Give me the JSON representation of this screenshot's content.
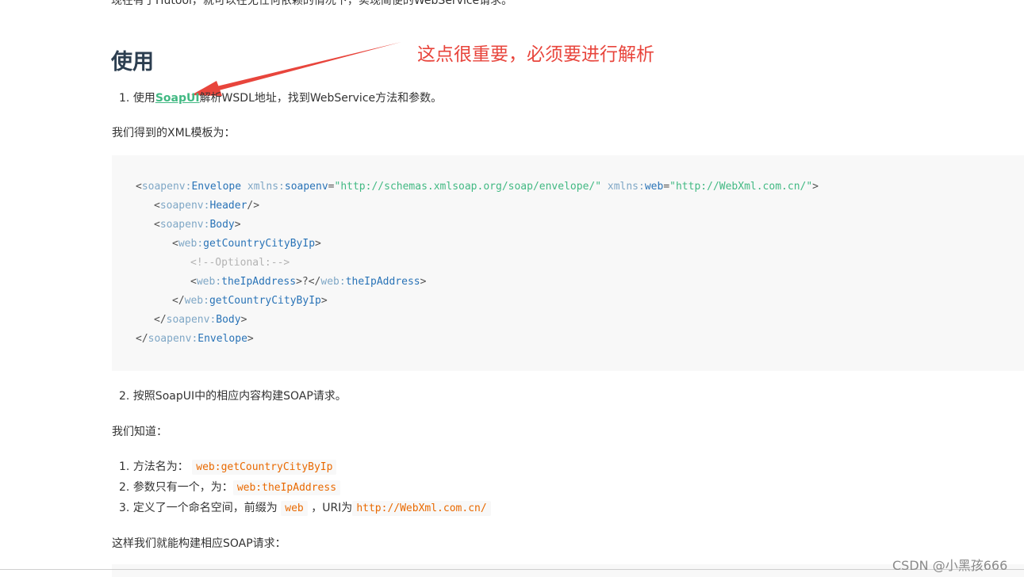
{
  "top_cutoff_text": "现在有了Hutool，就可以在无任何依赖的情况下，实现简便的WebService请求。",
  "section_heading": "使用",
  "annotation_text": "这点很重要，必须要进行解析",
  "step1": {
    "number": "1.",
    "prefix": "使用",
    "link": "SoapUI",
    "suffix": "解析WSDL地址，找到WebService方法和参数。"
  },
  "xml_intro": "我们得到的XML模板为：",
  "code_lines": [
    {
      "indent": 0,
      "tokens": [
        [
          "p",
          "<"
        ],
        [
          "ns",
          "soapenv"
        ],
        [
          "ns",
          ":"
        ],
        [
          "name",
          "Envelope"
        ],
        [
          "p",
          " "
        ],
        [
          "ns",
          "xmlns"
        ],
        [
          "ns",
          ":"
        ],
        [
          "attr",
          "soapenv"
        ],
        [
          "p",
          "="
        ],
        [
          "str",
          "\"http://schemas.xmlsoap.org/soap/envelope/\""
        ],
        [
          "p",
          " "
        ],
        [
          "ns",
          "xmlns"
        ],
        [
          "ns",
          ":"
        ],
        [
          "attr",
          "web"
        ],
        [
          "p",
          "="
        ],
        [
          "str",
          "\"http://WebXml.com.cn/\""
        ],
        [
          "p",
          ">"
        ]
      ]
    },
    {
      "indent": 1,
      "tokens": [
        [
          "p",
          "<"
        ],
        [
          "ns",
          "soapenv"
        ],
        [
          "ns",
          ":"
        ],
        [
          "name",
          "Header"
        ],
        [
          "p",
          "/>"
        ]
      ]
    },
    {
      "indent": 1,
      "tokens": [
        [
          "p",
          "<"
        ],
        [
          "ns",
          "soapenv"
        ],
        [
          "ns",
          ":"
        ],
        [
          "name",
          "Body"
        ],
        [
          "p",
          ">"
        ]
      ]
    },
    {
      "indent": 2,
      "tokens": [
        [
          "p",
          "<"
        ],
        [
          "ns",
          "web"
        ],
        [
          "ns",
          ":"
        ],
        [
          "name",
          "getCountryCityByIp"
        ],
        [
          "p",
          ">"
        ]
      ]
    },
    {
      "indent": 3,
      "tokens": [
        [
          "cm",
          "<!--Optional:-->"
        ]
      ]
    },
    {
      "indent": 3,
      "tokens": [
        [
          "p",
          "<"
        ],
        [
          "ns",
          "web"
        ],
        [
          "ns",
          ":"
        ],
        [
          "name",
          "theIpAddress"
        ],
        [
          "p",
          ">?</"
        ],
        [
          "ns",
          "web"
        ],
        [
          "ns",
          ":"
        ],
        [
          "name",
          "theIpAddress"
        ],
        [
          "p",
          ">"
        ]
      ]
    },
    {
      "indent": 2,
      "tokens": [
        [
          "p",
          "</"
        ],
        [
          "ns",
          "web"
        ],
        [
          "ns",
          ":"
        ],
        [
          "name",
          "getCountryCityByIp"
        ],
        [
          "p",
          ">"
        ]
      ]
    },
    {
      "indent": 1,
      "tokens": [
        [
          "p",
          "</"
        ],
        [
          "ns",
          "soapenv"
        ],
        [
          "ns",
          ":"
        ],
        [
          "name",
          "Body"
        ],
        [
          "p",
          ">"
        ]
      ]
    },
    {
      "indent": 0,
      "tokens": [
        [
          "p",
          "</"
        ],
        [
          "ns",
          "soapenv"
        ],
        [
          "ns",
          ":"
        ],
        [
          "name",
          "Envelope"
        ],
        [
          "p",
          ">"
        ]
      ]
    }
  ],
  "step2": {
    "number": "2.",
    "text": "按照SoapUI中的相应内容构建SOAP请求。"
  },
  "we_know": "我们知道：",
  "facts": [
    {
      "number": "1.",
      "prefix": "方法名为：",
      "code": "web:getCountryCityByIp",
      "mid": "",
      "code2": "",
      "suffix": ""
    },
    {
      "number": "2.",
      "prefix": "参数只有一个，为：",
      "code": "web:theIpAddress",
      "mid": "",
      "code2": "",
      "suffix": ""
    },
    {
      "number": "3.",
      "prefix": "定义了一个命名空间，前缀为",
      "code": "web",
      "mid": "，URI为",
      "code2": "http://WebXml.com.cn/",
      "suffix": ""
    }
  ],
  "build_text": "这样我们就能构建相应SOAP请求：",
  "watermark": "CSDN @小黑孩666",
  "colors": {
    "link": "#42b983",
    "annotation": "#e8453c",
    "heading": "#2c3e50",
    "inline_code": "#e96900",
    "code_bg": "#f8f8f8"
  }
}
